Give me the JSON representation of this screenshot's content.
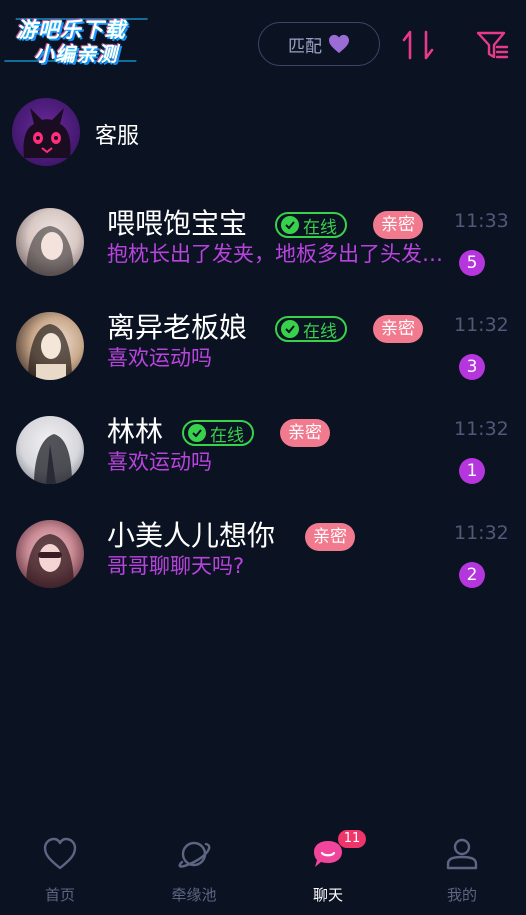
{
  "header": {
    "logo_line1": "游吧乐下载",
    "logo_line2": "小编亲测",
    "match_label": "匹配",
    "accent_color": "#e83a8a",
    "heart_color": "#9b6cd6"
  },
  "service": {
    "name": "客服",
    "avatar_icon": "cat-avatar-icon"
  },
  "chats": [
    {
      "name": "喂喂饱宝宝",
      "online": true,
      "online_label": "在线",
      "intimate_label": "亲密",
      "time": "11:33",
      "message": "抱枕长出了发夹，地板多出了头发丝，我的拖鞋旁多了双...",
      "unread": "5"
    },
    {
      "name": "离异老板娘",
      "online": true,
      "online_label": "在线",
      "intimate_label": "亲密",
      "time": "11:32",
      "message": "喜欢运动吗",
      "unread": "3"
    },
    {
      "name": "林林",
      "online": true,
      "online_label": "在线",
      "intimate_label": "亲密",
      "time": "11:32",
      "message": "喜欢运动吗",
      "unread": "1"
    },
    {
      "name": "小美人儿想你",
      "online": false,
      "online_label": "",
      "intimate_label": "亲密",
      "time": "11:32",
      "message": "哥哥聊聊天吗?",
      "unread": "2"
    }
  ],
  "tabs": [
    {
      "label": "首页",
      "icon": "heart-outline-icon",
      "active": false
    },
    {
      "label": "牵缘池",
      "icon": "planet-icon",
      "active": false
    },
    {
      "label": "聊天",
      "icon": "chat-bubble-icon",
      "active": true,
      "badge": "11"
    },
    {
      "label": "我的",
      "icon": "user-icon",
      "active": false
    }
  ],
  "colors": {
    "background": "#0b1222",
    "online_green": "#38d14c",
    "intimate_pink": "#f27a8e",
    "message_purple": "#b844de",
    "badge_purple": "#b536dd",
    "tab_badge_red": "#f0356a"
  }
}
